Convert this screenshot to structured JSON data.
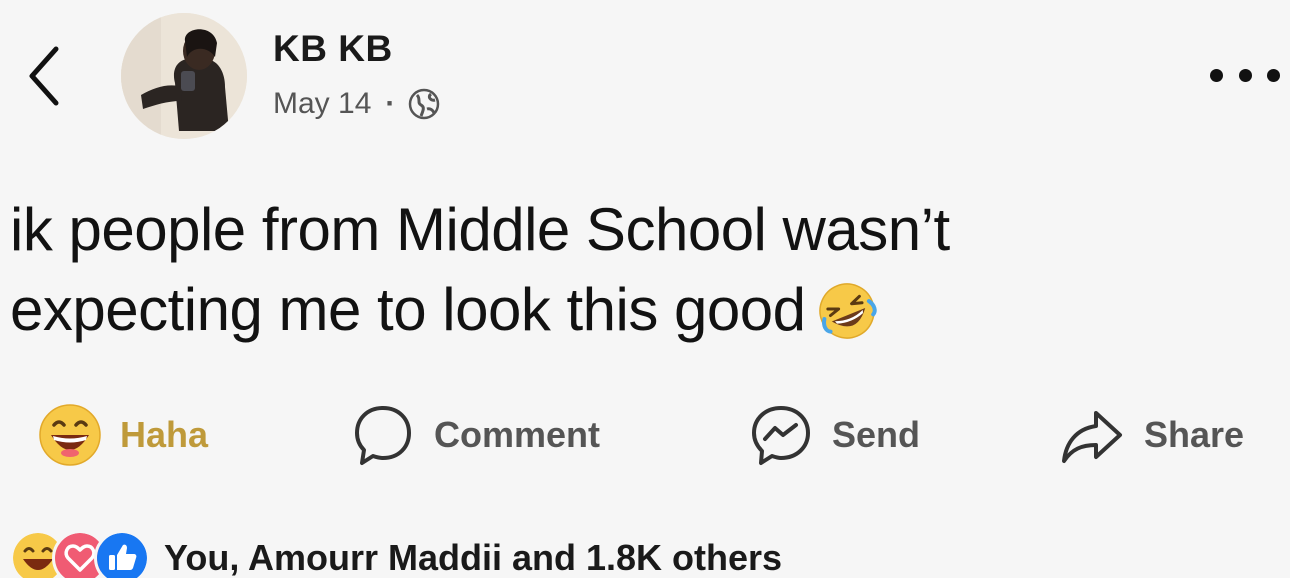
{
  "header": {
    "back_icon": "chevron-left-icon",
    "author_name": "KB KB",
    "date": "May 14",
    "separator": "·",
    "privacy_icon": "globe-icon",
    "more_icon": "more-horizontal-icon"
  },
  "post": {
    "line1": "ik people from Middle School wasn’t",
    "line2": "expecting me to look this good",
    "emoji": "rolling-on-floor-laughing-emoji"
  },
  "actions": {
    "haha_label": "Haha",
    "comment_label": "Comment",
    "send_label": "Send",
    "share_label": "Share"
  },
  "reactions": {
    "summary": "You, Amourr Maddii and 1.8K others",
    "icons": [
      "haha-reaction-icon",
      "love-reaction-icon",
      "like-reaction-icon"
    ]
  },
  "colors": {
    "background": "#f6f6f6",
    "text": "#121212",
    "muted": "#555555",
    "haha_label": "#bf9a3a",
    "haha_yellow": "#f7c948",
    "love_red": "#f05b73",
    "like_blue": "#1877f2"
  }
}
